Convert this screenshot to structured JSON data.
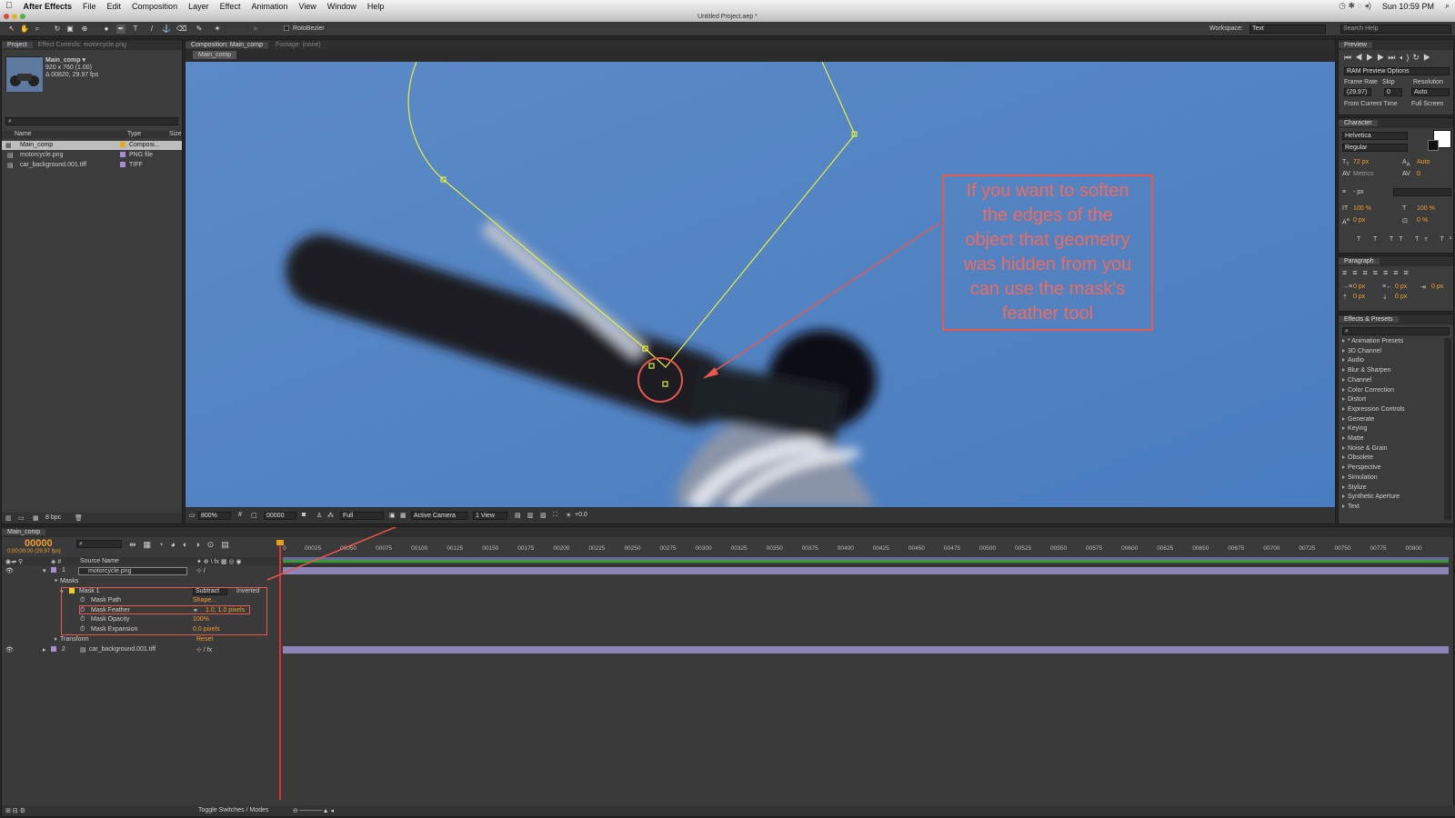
{
  "menubar": {
    "app": "After Effects",
    "items": [
      "File",
      "Edit",
      "Composition",
      "Layer",
      "Effect",
      "Animation",
      "View",
      "Window",
      "Help"
    ],
    "clock": "Sun 10:59 PM"
  },
  "window": {
    "title": "Untitled Project.aep *"
  },
  "toolbar": {
    "rotobezier": "RotoBezier",
    "workspace_label": "Workspace:",
    "workspace_value": "Text",
    "search_placeholder": "Search Help"
  },
  "project": {
    "tab": "Project",
    "tab2": "Effect Controls: motorcycle.png",
    "comp_name": "Main_comp ▾",
    "comp_size": "920 x 760 (1.00)",
    "comp_dur": "Δ 00820, 29.97 fps",
    "cols": [
      "Name",
      "Type",
      "Size"
    ],
    "items": [
      {
        "name": "Main_comp",
        "type": "Composi..."
      },
      {
        "name": "motorcycle.png",
        "type": "PNG file"
      },
      {
        "name": "car_background.001.tiff",
        "type": "TIFF"
      }
    ],
    "bpc": "8 bpc"
  },
  "composition": {
    "tab": "Composition: Main_comp",
    "footage": "Footage: (none)",
    "subtab": "Main_comp",
    "zoom": "800%",
    "timecode": "00000",
    "quality": "Full",
    "camera": "Active Camera",
    "view": "1 View",
    "exposure": "+0.0"
  },
  "annotation": {
    "text": "If you want to soften the edges of the object that geometry was hidden from you can use the mask's feather tool",
    "color": "#e8584e"
  },
  "preview": {
    "tab": "Preview",
    "ram": "RAM Preview Options",
    "frame_rate_label": "Frame Rate",
    "skip_label": "Skip",
    "res_label": "Resolution",
    "frame_rate": "(29.97)",
    "skip": "0",
    "res": "Auto",
    "from_current": "From Current Time",
    "full_screen": "Full Screen"
  },
  "character": {
    "tab": "Character",
    "font": "Helvetica",
    "style": "Regular",
    "size": "72 px",
    "leading": "Auto",
    "kerning": "Metrics",
    "tracking": "0",
    "stroke": "- px",
    "vscale": "100 %",
    "hscale": "100 %",
    "baseline": "0 px",
    "tsume": "0 %"
  },
  "paragraph": {
    "tab": "Paragraph",
    "indent1": "0 px",
    "indent2": "0 px",
    "indent3": "0 px",
    "space1": "0 px",
    "space2": "0 px"
  },
  "effects": {
    "tab": "Effects & Presets",
    "items": [
      "* Animation Presets",
      "3D Channel",
      "Audio",
      "Blur & Sharpen",
      "Channel",
      "Color Correction",
      "Distort",
      "Expression Controls",
      "Generate",
      "Keying",
      "Matte",
      "Noise & Grain",
      "Obsolete",
      "Perspective",
      "Simulation",
      "Stylize",
      "Synthetic Aperture",
      "Text"
    ]
  },
  "timeline": {
    "tab": "Main_comp",
    "timecode": "00000",
    "timecode_sub": "0;00;00;00 (29.97 fps)",
    "source_col": "Source Name",
    "ticks": [
      "00025",
      "00050",
      "00075",
      "00100",
      "00125",
      "00150",
      "00175",
      "00200",
      "00225",
      "00250",
      "00275",
      "00300",
      "00325",
      "00350",
      "00375",
      "00400",
      "00425",
      "00450",
      "00475",
      "00500",
      "00525",
      "00550",
      "00575",
      "00600",
      "00625",
      "00650",
      "00675",
      "00700",
      "00725",
      "00750",
      "00775",
      "00800"
    ],
    "start_tick": "0",
    "layer1": {
      "num": "1",
      "name": "motorcycle.png"
    },
    "masks_label": "Masks",
    "mask1": "Mask 1",
    "mask_mode": "Subtract",
    "inverted": "Inverted",
    "props": [
      {
        "name": "Mask Path",
        "value": "Shape..."
      },
      {
        "name": "Mask Feather",
        "value": "1.0, 1.0 pixels"
      },
      {
        "name": "Mask Opacity",
        "value": "100%"
      },
      {
        "name": "Mask Expansion",
        "value": "0.0 pixels"
      }
    ],
    "transform": "Transform",
    "reset": "Reset",
    "layer2": {
      "num": "2",
      "name": "car_background.001.tiff"
    },
    "toggle": "Toggle Switches / Modes"
  }
}
